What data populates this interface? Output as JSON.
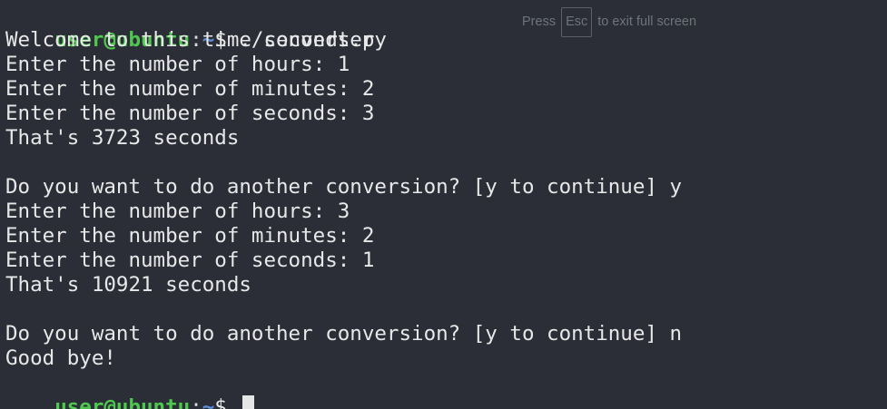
{
  "prompt": {
    "user": "user@ubuntu",
    "colon": ":",
    "path": "~",
    "dollar": "$ "
  },
  "command": "./seconds.py",
  "output_lines": [
    "Welcome to this time converter",
    "Enter the number of hours: 1",
    "Enter the number of minutes: 2",
    "Enter the number of seconds: 3",
    "That's 3723 seconds",
    "",
    "Do you want to do another conversion? [y to continue] y",
    "Enter the number of hours: 3",
    "Enter the number of minutes: 2",
    "Enter the number of seconds: 1",
    "That's 10921 seconds",
    "",
    "Do you want to do another conversion? [y to continue] n",
    "Good bye!"
  ],
  "fullscreen_hint": {
    "press": "Press",
    "key": "Esc",
    "rest": "to exit full screen"
  }
}
